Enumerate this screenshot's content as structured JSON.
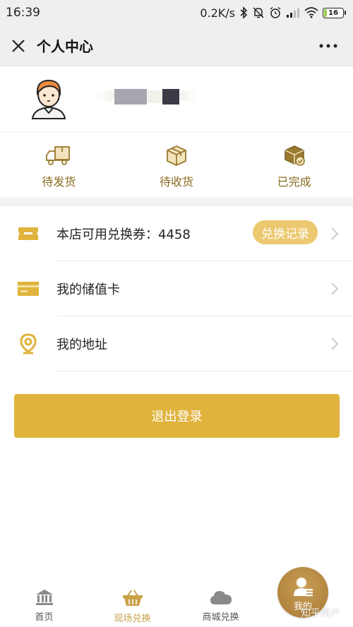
{
  "status_bar": {
    "time": "16:39",
    "net_speed": "0.2K/s",
    "battery": "16"
  },
  "header": {
    "title": "个人中心"
  },
  "orders": [
    {
      "label": "待发货",
      "icon": "truck-icon"
    },
    {
      "label": "待收货",
      "icon": "package-icon"
    },
    {
      "label": "已完成",
      "icon": "package-done-icon"
    }
  ],
  "menu": {
    "voucher_label": "本店可用兑换券：4458",
    "voucher_button": "兑换记录",
    "card_label": "我的储值卡",
    "address_label": "我的地址"
  },
  "logout_label": "退出登录",
  "tabs": [
    {
      "label": "首页",
      "icon": "bank-icon"
    },
    {
      "label": "现场兑换",
      "icon": "basket-icon"
    },
    {
      "label": "商城兑换",
      "icon": "cloud-icon"
    },
    {
      "label": "我的",
      "icon": "user-icon"
    }
  ],
  "watermark": "知乎用户",
  "colors": {
    "accent": "#e0b33d",
    "accent_light": "#ecc970",
    "order_text": "#8a6a20",
    "active_tab": "#c9a24a"
  }
}
